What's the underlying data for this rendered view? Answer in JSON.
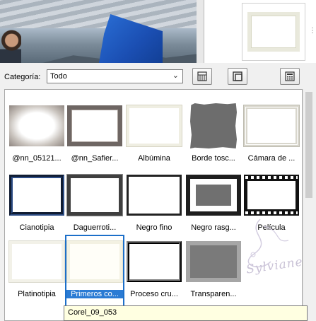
{
  "toolbar": {
    "category_label": "Categoría:",
    "category_value": "Todo"
  },
  "items": [
    {
      "label": "@nn_05121...",
      "style": "vignette"
    },
    {
      "label": "@nn_Safier...",
      "style": "dark"
    },
    {
      "label": "Albúmina",
      "style": "albumina"
    },
    {
      "label": "Borde tosc...",
      "style": "borde"
    },
    {
      "label": "Cámara de ...",
      "style": "camara"
    },
    {
      "label": "Cianotipia",
      "style": "ciano"
    },
    {
      "label": "Daguerroti...",
      "style": "daguerro"
    },
    {
      "label": "Negro fino",
      "style": "negrofino"
    },
    {
      "label": "Negro rasg...",
      "style": "negrorasg"
    },
    {
      "label": "Película",
      "style": "pelicula"
    },
    {
      "label": "Platinotipia",
      "style": "platino"
    },
    {
      "label": "Primeros co...",
      "style": "primeros",
      "selected": true
    },
    {
      "label": "Proceso cru...",
      "style": "proceso"
    },
    {
      "label": "Transparen...",
      "style": "transp"
    }
  ],
  "tooltip": {
    "text": "Corel_09_053"
  },
  "watermark": {
    "signature": "Sylviane"
  }
}
